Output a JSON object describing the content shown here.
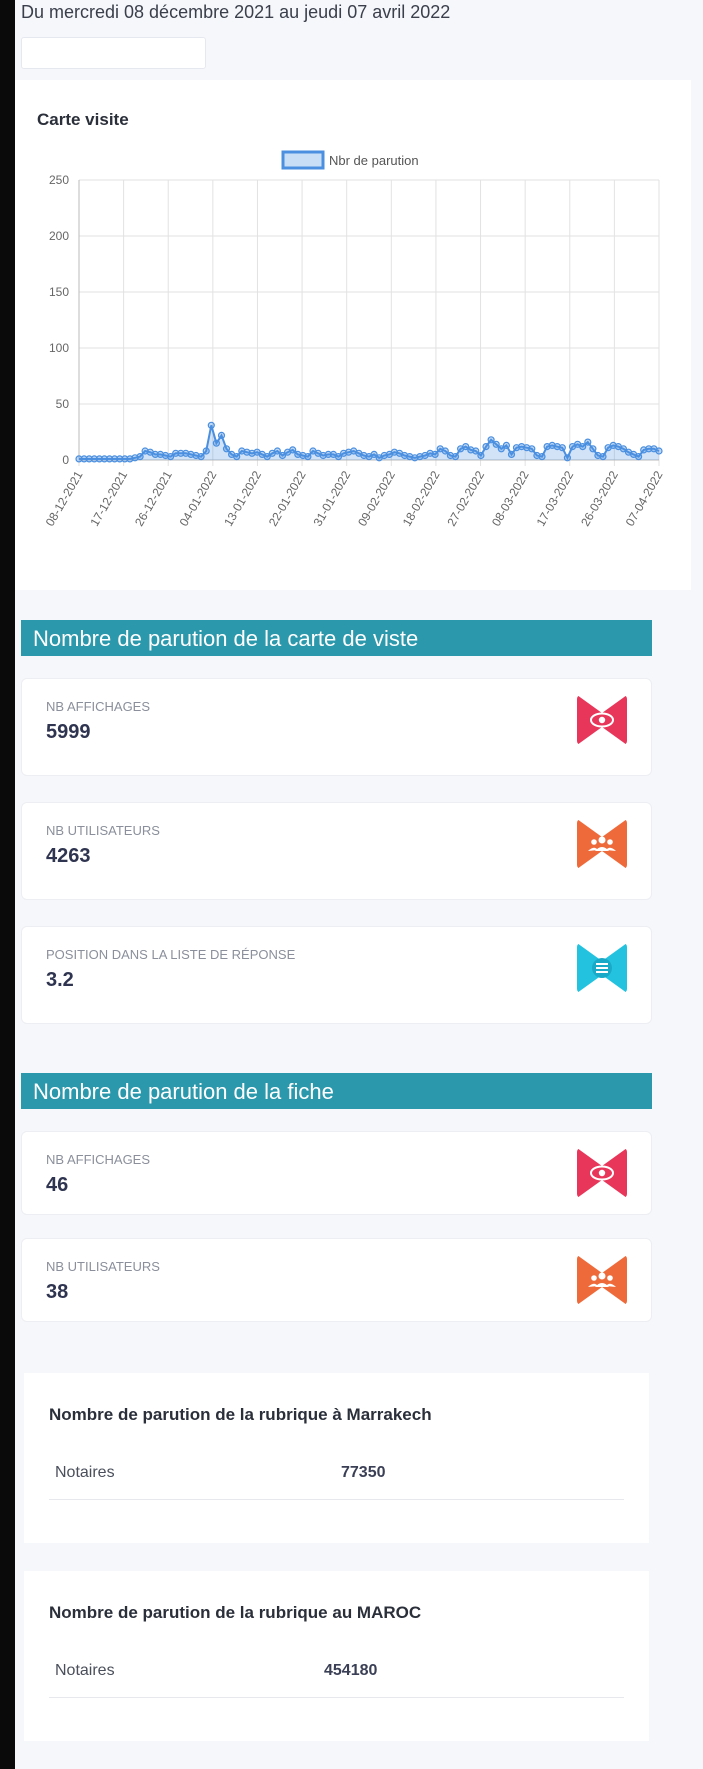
{
  "header": {
    "date_range": "Du mercredi 08 décembre 2021 au jeudi 07 avril 2022"
  },
  "chart_card": {
    "title": "Carte visite"
  },
  "chart_data": {
    "type": "line",
    "title": "Carte visite",
    "legend": "Nbr de parution",
    "legend_position": "top",
    "grid": true,
    "ylim": [
      0,
      250
    ],
    "y_ticks": [
      0,
      50,
      100,
      150,
      200,
      250
    ],
    "x_tick_labels": [
      "08-12-2021",
      "17-12-2021",
      "26-12-2021",
      "04-01-2022",
      "13-01-2022",
      "22-01-2022",
      "31-01-2022",
      "09-02-2022",
      "18-02-2022",
      "27-02-2022",
      "08-03-2022",
      "17-03-2022",
      "26-03-2022",
      "07-04-2022"
    ],
    "series": [
      {
        "name": "Nbr de parution",
        "color": "#4a8fe0",
        "values": [
          1,
          1,
          1,
          1,
          1,
          1,
          1,
          1,
          1,
          1,
          1,
          2,
          3,
          8,
          7,
          5,
          5,
          4,
          3,
          6,
          6,
          6,
          5,
          4,
          3,
          8,
          31,
          15,
          22,
          10,
          5,
          3,
          8,
          7,
          6,
          7,
          5,
          3,
          6,
          8,
          4,
          7,
          9,
          5,
          4,
          3,
          8,
          6,
          4,
          5,
          5,
          3,
          6,
          7,
          8,
          6,
          4,
          3,
          5,
          2,
          4,
          5,
          7,
          6,
          4,
          3,
          2,
          3,
          4,
          6,
          5,
          10,
          8,
          4,
          3,
          10,
          12,
          9,
          8,
          4,
          12,
          18,
          14,
          10,
          13,
          5,
          11,
          12,
          11,
          10,
          4,
          3,
          12,
          13,
          12,
          11,
          2,
          12,
          14,
          12,
          16,
          10,
          4,
          3,
          11,
          13,
          12,
          10,
          7,
          5,
          3,
          9,
          10,
          10,
          8
        ]
      }
    ]
  },
  "section_carte": {
    "title": "Nombre de parution de la carte de viste",
    "cards": [
      {
        "label": "NB AFFICHAGES",
        "value": "5999",
        "icon": "eye-icon",
        "color": "#e8365a"
      },
      {
        "label": "NB UTILISATEURS",
        "value": "4263",
        "icon": "users-icon",
        "color": "#ef6a3a"
      },
      {
        "label": "POSITION DANS LA LISTE DE RÉPONSE",
        "value": "3.2",
        "icon": "list-icon",
        "color": "#23c3e0"
      }
    ]
  },
  "section_fiche": {
    "title": "Nombre de parution de la fiche",
    "cards": [
      {
        "label": "NB AFFICHAGES",
        "value": "46",
        "icon": "eye-icon",
        "color": "#e8365a"
      },
      {
        "label": "NB UTILISATEURS",
        "value": "38",
        "icon": "users-icon",
        "color": "#ef6a3a"
      }
    ]
  },
  "rubrique_marrakech": {
    "title": "Nombre de parution de la rubrique à Marrakech",
    "name": "Notaires",
    "value": "77350"
  },
  "rubrique_maroc": {
    "title": "Nombre de parution de la rubrique au MAROC",
    "name": "Notaires",
    "value": "454180"
  }
}
